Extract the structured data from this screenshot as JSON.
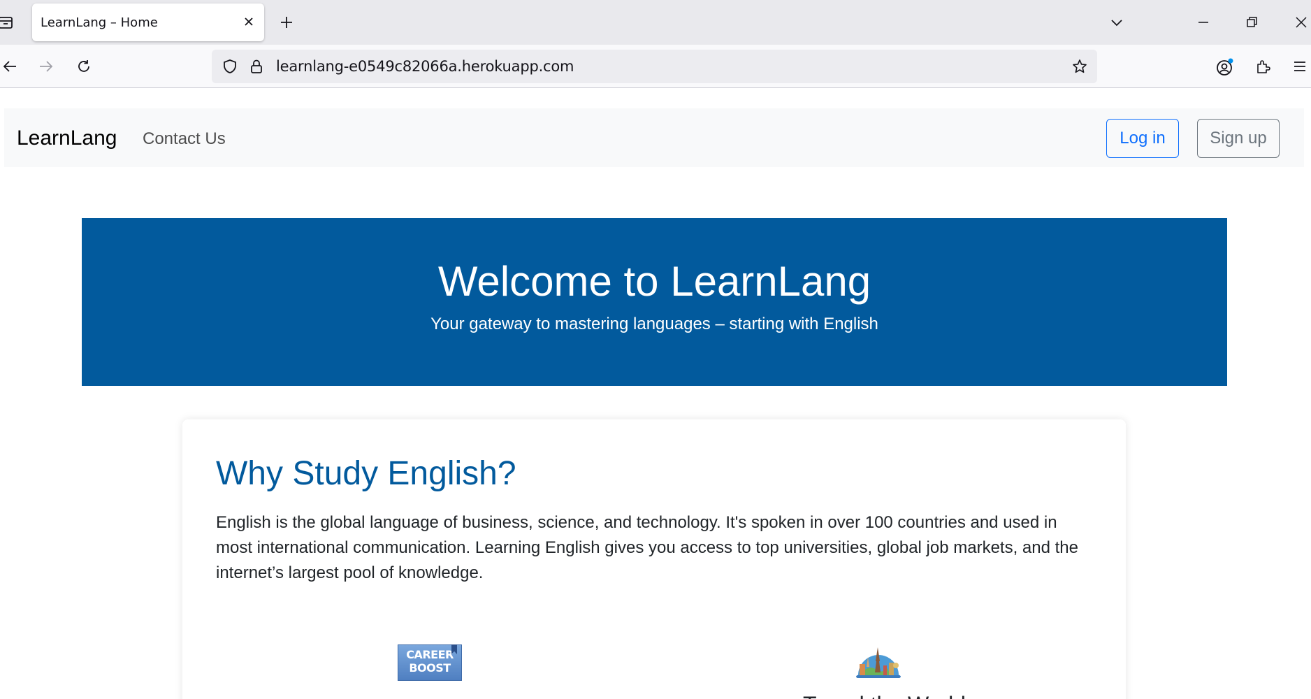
{
  "browser": {
    "tab_title": "LearnLang – Home",
    "url": "learnlang-e0549c82066a.herokuapp.com"
  },
  "nav": {
    "brand": "LearnLang",
    "contact": "Contact Us",
    "login": "Log in",
    "signup": "Sign up"
  },
  "hero": {
    "title": "Welcome to LearnLang",
    "subtitle": "Your gateway to mastering languages – starting with English"
  },
  "why": {
    "title": "Why Study English?",
    "body": "English is the global language of business, science, and technology. It's spoken in over 100 countries and used in most international communication. Learning English gives you access to top universities, global job markets, and the internet’s largest pool of knowledge.",
    "features": [
      {
        "icon_text": "CAREER BOOST",
        "icon": "career-boost-icon"
      },
      {
        "title": "Travel the World",
        "icon": "travel-world-icon"
      }
    ]
  },
  "colors": {
    "brand_blue": "#025a9d",
    "primary": "#0d6efd",
    "secondary": "#6c757d"
  }
}
